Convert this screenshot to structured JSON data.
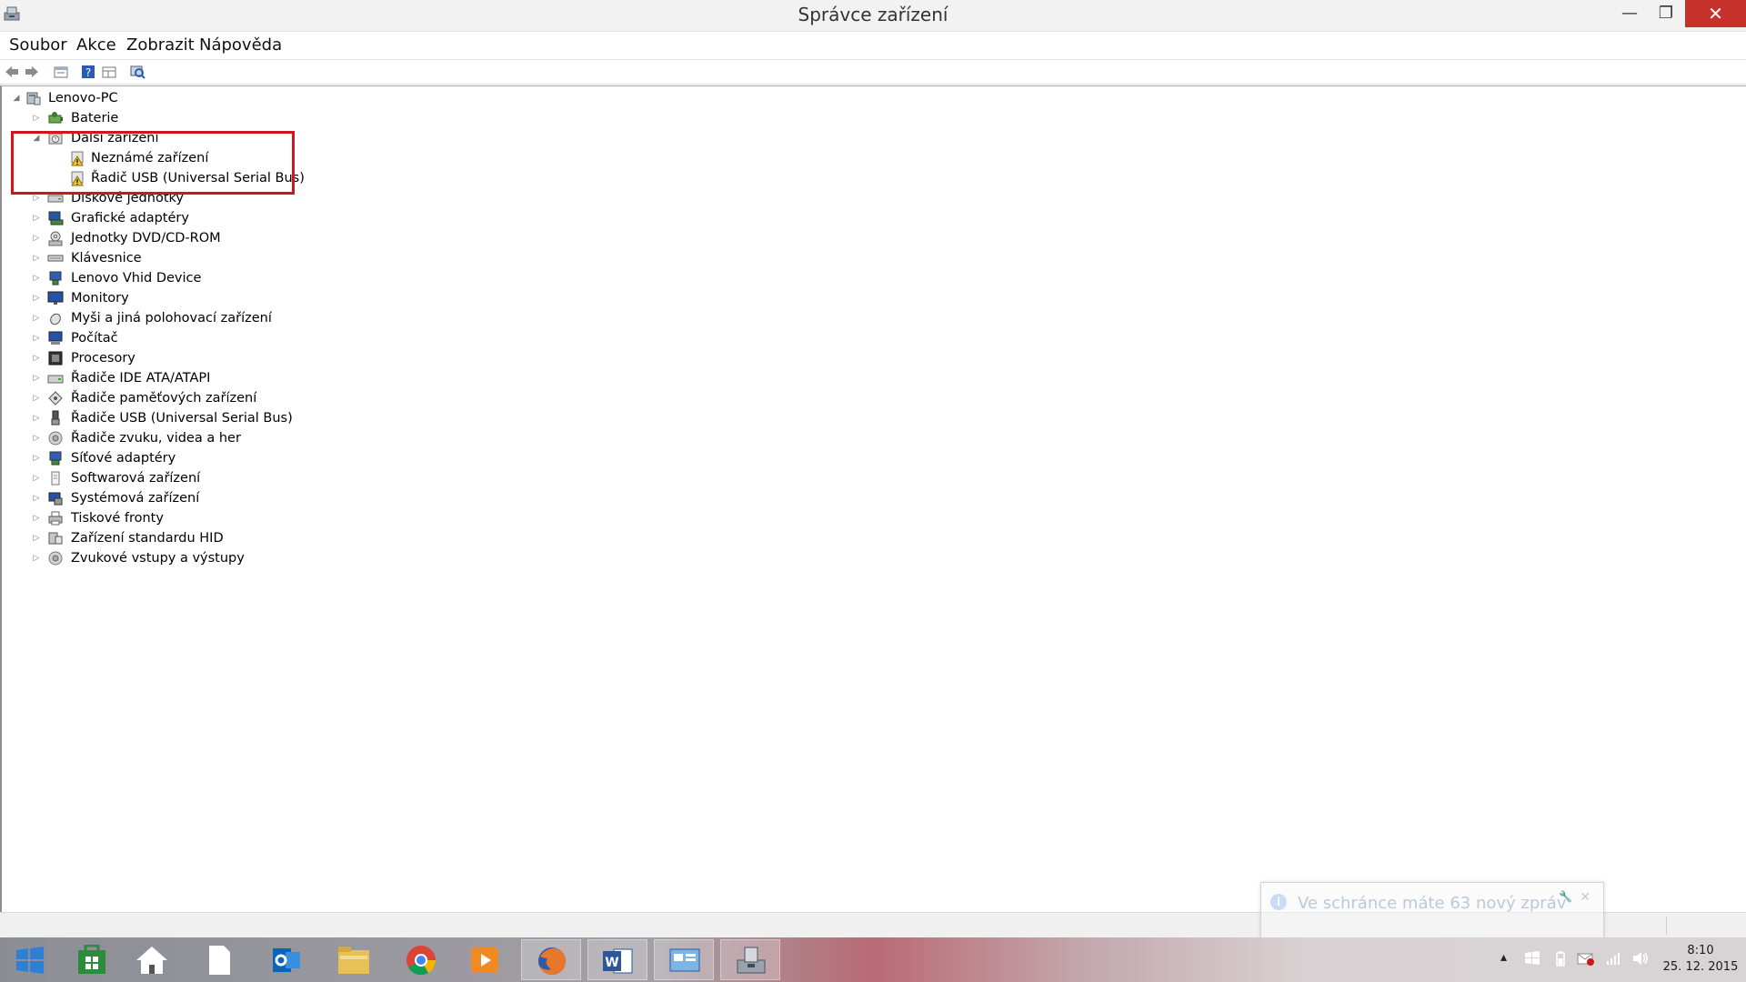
{
  "window": {
    "title": "Správce zařízení",
    "controls": {
      "minimize": "—",
      "maximize": "❐",
      "close": "✕"
    }
  },
  "menu": [
    "Soubor",
    "Akce",
    "Zobrazit",
    "Nápověda"
  ],
  "toolbar": [
    "back-icon",
    "forward-icon",
    "properties-icon",
    "help-icon",
    "view-icon",
    "scan-hardware-icon"
  ],
  "tree": {
    "root": "Lenovo-PC",
    "categories": [
      {
        "label": "Baterie",
        "icon": "battery-icon",
        "expanded": false
      },
      {
        "label": "Další zařízení",
        "icon": "other-devices-icon",
        "expanded": true,
        "children": [
          "Neznámé zařízení",
          "Řadič USB (Universal Serial Bus)"
        ]
      },
      {
        "label": "Diskové jednotky",
        "icon": "disk-drive-icon",
        "expanded": false
      },
      {
        "label": "Grafické adaptéry",
        "icon": "display-adapter-icon",
        "expanded": false
      },
      {
        "label": "Jednotky DVD/CD-ROM",
        "icon": "dvd-drive-icon",
        "expanded": false
      },
      {
        "label": "Klávesnice",
        "icon": "keyboard-icon",
        "expanded": false
      },
      {
        "label": "Lenovo Vhid Device",
        "icon": "hid-device-icon",
        "expanded": false
      },
      {
        "label": "Monitory",
        "icon": "monitor-icon",
        "expanded": false
      },
      {
        "label": "Myši a jiná polohovací zařízení",
        "icon": "mouse-icon",
        "expanded": false
      },
      {
        "label": "Počítač",
        "icon": "computer-icon",
        "expanded": false
      },
      {
        "label": "Procesory",
        "icon": "processor-icon",
        "expanded": false
      },
      {
        "label": "Řadiče IDE ATA/ATAPI",
        "icon": "ide-controller-icon",
        "expanded": false
      },
      {
        "label": "Řadiče paměťových zařízení",
        "icon": "storage-controller-icon",
        "expanded": false
      },
      {
        "label": "Řadiče USB (Universal Serial Bus)",
        "icon": "usb-icon",
        "expanded": false
      },
      {
        "label": "Řadiče zvuku, videa a her",
        "icon": "sound-icon",
        "expanded": false
      },
      {
        "label": "Síťové adaptéry",
        "icon": "network-adapter-icon",
        "expanded": false
      },
      {
        "label": "Softwarová zařízení",
        "icon": "software-device-icon",
        "expanded": false
      },
      {
        "label": "Systémová zařízení",
        "icon": "system-device-icon",
        "expanded": false
      },
      {
        "label": "Tiskové fronty",
        "icon": "printer-icon",
        "expanded": false
      },
      {
        "label": "Zařízení standardu HID",
        "icon": "hid-icon",
        "expanded": false
      },
      {
        "label": "Zvukové vstupy a výstupy",
        "icon": "audio-io-icon",
        "expanded": false
      }
    ]
  },
  "notification": {
    "message": "Ve schránce máte 63 nový zpráv"
  },
  "taskbar": {
    "apps": [
      "start-icon",
      "store-icon",
      "home-icon",
      "file-icon",
      "outlook-icon",
      "explorer-icon",
      "chrome-icon",
      "media-player-icon",
      "firefox-icon",
      "word-icon",
      "control-panel-icon",
      "device-manager-icon"
    ],
    "clock": {
      "time": "8:10",
      "date": "25. 12. 2015"
    }
  },
  "colors": {
    "highlight": "#d0161b",
    "close_button": "#c7312b",
    "tree_text": "#000000"
  }
}
